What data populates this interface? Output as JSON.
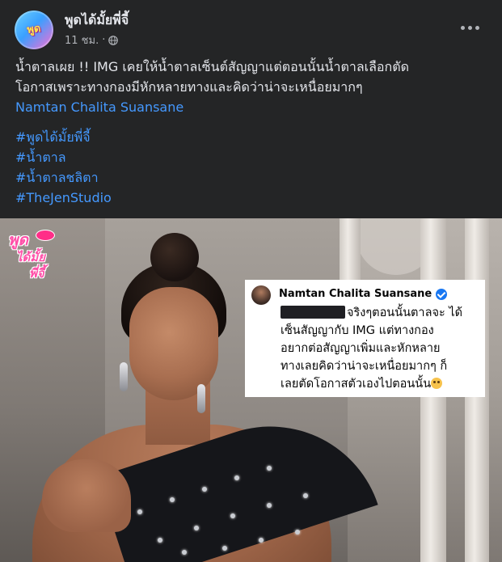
{
  "header": {
    "page_name": "พูดได้มั้ยพี่จี้",
    "avatar_text": "พูด",
    "timestamp": "11 ชม.",
    "separator": "·",
    "privacy_icon": "globe-icon",
    "more_icon": "more-options-icon"
  },
  "post": {
    "text_line_1": "น้ำตาลเผย !! IMG เคยให้น้ำตาลเซ็นต์สัญญาแต่ตอนนั้นน้ำตาลเลือกตัด",
    "text_line_2": "โอกาสเพราะทางกองมีหักหลายทางและคิดว่าน่าจะเหนื่อยมากๆ",
    "mention": "Namtan Chalita Suansane",
    "hashtags": [
      "#พูดได้มั้ยพี่จี้",
      "#น้ำตาล",
      "#น้ำตาลชลิตา",
      "#TheJenStudio"
    ]
  },
  "image": {
    "watermark_line_1": "พูด",
    "watermark_line_2": "ได้มั้ย",
    "watermark_line_3": "พี่จี้",
    "comment": {
      "author": "Namtan Chalita Suansane",
      "verified_icon": "verified-badge-icon",
      "lines": [
        "จริงๆตอนนั้นตาลจะ ได้",
        "เซ็นสัญญากับ IMG แต่ทางกอง",
        "อยากต่อสัญญาเพิ่มและหักหลาย",
        "ทางเลยคิดว่าน่าจะเหนื่อยมากๆ ก็",
        "เลยตัดโอกาสตัวเองไปตอนนั้น"
      ],
      "emoji_icon": "pleading-face-emoji-icon"
    }
  },
  "colors": {
    "background": "#242526",
    "text_primary": "#e4e6eb",
    "text_secondary": "#b0b3b8",
    "link": "#4599ff",
    "verified": "#1877f2"
  }
}
